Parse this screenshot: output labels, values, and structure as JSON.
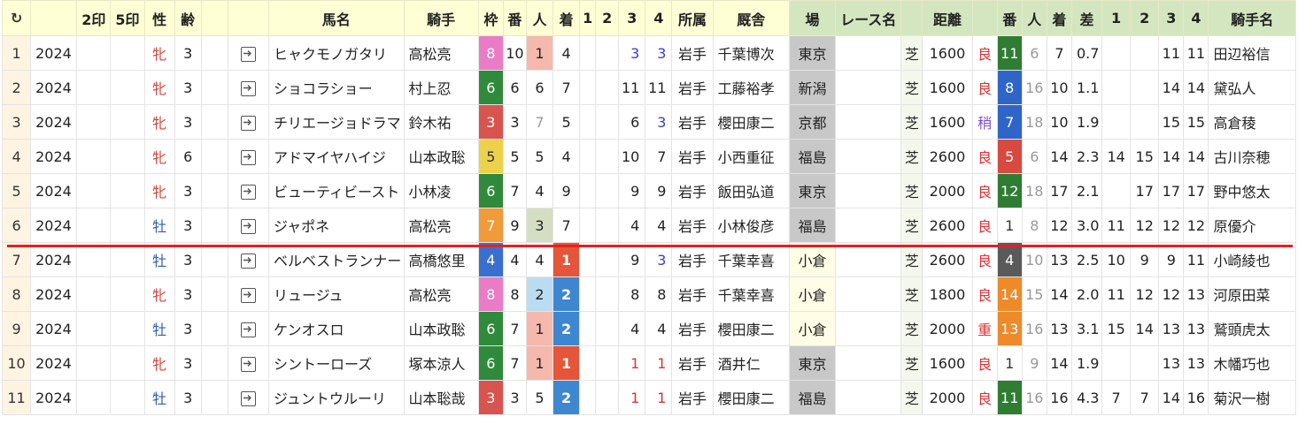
{
  "headers": {
    "refresh": "↻",
    "col2": "",
    "col3": "",
    "mark2": "2印",
    "mark5": "5印",
    "sex": "性",
    "age": "齢",
    "col8": "",
    "horse": "馬名",
    "jockey": "騎手",
    "waku": "枠",
    "ban": "番",
    "pop": "人",
    "finish": "着",
    "c1": "1",
    "c2": "2",
    "c3": "3",
    "c4": "4",
    "affil": "所属",
    "stable": "厩舎",
    "track": "場",
    "race": "レース名",
    "surface": "",
    "dist": "距離",
    "cond": "",
    "ban2": "番",
    "pop2": "人",
    "finish2": "着",
    "margin": "差",
    "p1": "1",
    "p2": "2",
    "p3": "3",
    "p4": "4",
    "jockey2": "騎手名"
  },
  "rows": [
    {
      "no": "1",
      "year": "2024",
      "sex": "牝",
      "age": "3",
      "horse": "ヒャクモノガタリ",
      "jockey": "高松亮",
      "waku": "8",
      "ban": "10",
      "pop": "1",
      "fin": "4",
      "c1": "",
      "c2": "",
      "c3": "3",
      "c4": "3",
      "affil": "岩手",
      "stable": "千葉博次",
      "track": "東京",
      "race": "",
      "surface": "芝",
      "dist": "1600",
      "cond": "良",
      "ban2": "11",
      "pop2": "6",
      "fin2": "7",
      "margin": "0.7",
      "p1": "",
      "p2": "",
      "p3": "11",
      "p4": "11",
      "jockey2": "田辺裕信"
    },
    {
      "no": "2",
      "year": "2024",
      "sex": "牝",
      "age": "3",
      "horse": "ショコラショー",
      "jockey": "村上忍",
      "waku": "6",
      "ban": "6",
      "pop": "6",
      "fin": "7",
      "c1": "",
      "c2": "",
      "c3": "11",
      "c4": "11",
      "affil": "岩手",
      "stable": "工藤裕孝",
      "track": "新潟",
      "race": "",
      "surface": "芝",
      "dist": "1600",
      "cond": "良",
      "ban2": "8",
      "pop2": "16",
      "fin2": "10",
      "margin": "1.1",
      "p1": "",
      "p2": "",
      "p3": "14",
      "p4": "14",
      "jockey2": "黛弘人"
    },
    {
      "no": "3",
      "year": "2024",
      "sex": "牝",
      "age": "3",
      "horse": "チリエージョドラマ",
      "jockey": "鈴木祐",
      "waku": "3",
      "ban": "3",
      "pop": "7",
      "fin": "5",
      "c1": "",
      "c2": "",
      "c3": "6",
      "c4": "3",
      "affil": "岩手",
      "stable": "櫻田康二",
      "track": "京都",
      "race": "",
      "surface": "芝",
      "dist": "1600",
      "cond": "稍",
      "ban2": "7",
      "pop2": "18",
      "fin2": "10",
      "margin": "1.9",
      "p1": "",
      "p2": "",
      "p3": "15",
      "p4": "15",
      "jockey2": "高倉稜"
    },
    {
      "no": "4",
      "year": "2024",
      "sex": "牝",
      "age": "6",
      "horse": "アドマイヤハイジ",
      "jockey": "山本政聡",
      "waku": "5",
      "ban": "5",
      "pop": "5",
      "fin": "4",
      "c1": "",
      "c2": "",
      "c3": "10",
      "c4": "7",
      "affil": "岩手",
      "stable": "小西重征",
      "track": "福島",
      "race": "",
      "surface": "芝",
      "dist": "2600",
      "cond": "良",
      "ban2": "5",
      "pop2": "6",
      "fin2": "14",
      "margin": "2.3",
      "p1": "14",
      "p2": "15",
      "p3": "14",
      "p4": "14",
      "jockey2": "古川奈穂"
    },
    {
      "no": "5",
      "year": "2024",
      "sex": "牝",
      "age": "3",
      "horse": "ビューティビースト",
      "jockey": "小林凌",
      "waku": "6",
      "ban": "7",
      "pop": "4",
      "fin": "9",
      "c1": "",
      "c2": "",
      "c3": "9",
      "c4": "9",
      "affil": "岩手",
      "stable": "飯田弘道",
      "track": "東京",
      "race": "",
      "surface": "芝",
      "dist": "2000",
      "cond": "良",
      "ban2": "12",
      "pop2": "18",
      "fin2": "17",
      "margin": "2.1",
      "p1": "",
      "p2": "17",
      "p3": "17",
      "p4": "17",
      "jockey2": "野中悠太"
    },
    {
      "no": "6",
      "year": "2024",
      "sex": "牡",
      "age": "3",
      "horse": "ジャポネ",
      "jockey": "高松亮",
      "waku": "7",
      "ban": "9",
      "pop": "3",
      "fin": "7",
      "c1": "",
      "c2": "",
      "c3": "4",
      "c4": "4",
      "affil": "岩手",
      "stable": "小林俊彦",
      "track": "福島",
      "race": "",
      "surface": "芝",
      "dist": "2600",
      "cond": "良",
      "ban2": "1",
      "pop2": "8",
      "fin2": "12",
      "margin": "3.0",
      "p1": "11",
      "p2": "12",
      "p3": "12",
      "p4": "12",
      "jockey2": "原優介"
    },
    {
      "no": "7",
      "year": "2024",
      "sex": "牡",
      "age": "3",
      "horse": "ベルベストランナー",
      "jockey": "高橋悠里",
      "waku": "4",
      "ban": "4",
      "pop": "4",
      "fin": "1",
      "c1": "",
      "c2": "",
      "c3": "9",
      "c4": "3",
      "affil": "岩手",
      "stable": "千葉幸喜",
      "track": "小倉",
      "race": "",
      "surface": "芝",
      "dist": "2600",
      "cond": "良",
      "ban2": "4",
      "pop2": "10",
      "fin2": "13",
      "margin": "2.5",
      "p1": "10",
      "p2": "9",
      "p3": "9",
      "p4": "11",
      "jockey2": "小崎綾也"
    },
    {
      "no": "8",
      "year": "2024",
      "sex": "牝",
      "age": "3",
      "horse": "リュージュ",
      "jockey": "高松亮",
      "waku": "8",
      "ban": "8",
      "pop": "2",
      "fin": "2",
      "c1": "",
      "c2": "",
      "c3": "8",
      "c4": "8",
      "affil": "岩手",
      "stable": "千葉幸喜",
      "track": "小倉",
      "race": "",
      "surface": "芝",
      "dist": "1800",
      "cond": "良",
      "ban2": "14",
      "pop2": "15",
      "fin2": "14",
      "margin": "2.0",
      "p1": "11",
      "p2": "12",
      "p3": "12",
      "p4": "13",
      "jockey2": "河原田菜"
    },
    {
      "no": "9",
      "year": "2024",
      "sex": "牡",
      "age": "3",
      "horse": "ケンオスロ",
      "jockey": "山本政聡",
      "waku": "6",
      "ban": "7",
      "pop": "1",
      "fin": "2",
      "c1": "",
      "c2": "",
      "c3": "4",
      "c4": "4",
      "affil": "岩手",
      "stable": "櫻田康二",
      "track": "小倉",
      "race": "",
      "surface": "芝",
      "dist": "2000",
      "cond": "重",
      "ban2": "13",
      "pop2": "16",
      "fin2": "13",
      "margin": "3.1",
      "p1": "15",
      "p2": "14",
      "p3": "13",
      "p4": "13",
      "jockey2": "鷲頭虎太"
    },
    {
      "no": "10",
      "year": "2024",
      "sex": "牝",
      "age": "3",
      "horse": "シントーローズ",
      "jockey": "塚本涼人",
      "waku": "6",
      "ban": "7",
      "pop": "1",
      "fin": "1",
      "c1": "",
      "c2": "",
      "c3": "1",
      "c4": "1",
      "affil": "岩手",
      "stable": "酒井仁",
      "track": "東京",
      "race": "",
      "surface": "芝",
      "dist": "1600",
      "cond": "良",
      "ban2": "1",
      "pop2": "9",
      "fin2": "14",
      "margin": "1.9",
      "p1": "",
      "p2": "",
      "p3": "13",
      "p4": "13",
      "jockey2": "木幡巧也"
    },
    {
      "no": "11",
      "year": "2024",
      "sex": "牡",
      "age": "3",
      "horse": "ジュントウルーリ",
      "jockey": "山本聡哉",
      "waku": "3",
      "ban": "3",
      "pop": "5",
      "fin": "2",
      "c1": "",
      "c2": "",
      "c3": "1",
      "c4": "1",
      "affil": "岩手",
      "stable": "櫻田康二",
      "track": "福島",
      "race": "",
      "surface": "芝",
      "dist": "2000",
      "cond": "良",
      "ban2": "11",
      "pop2": "16",
      "fin2": "16",
      "margin": "4.3",
      "p1": "7",
      "p2": "7",
      "p3": "14",
      "p4": "16",
      "jockey2": "菊沢一樹"
    }
  ]
}
